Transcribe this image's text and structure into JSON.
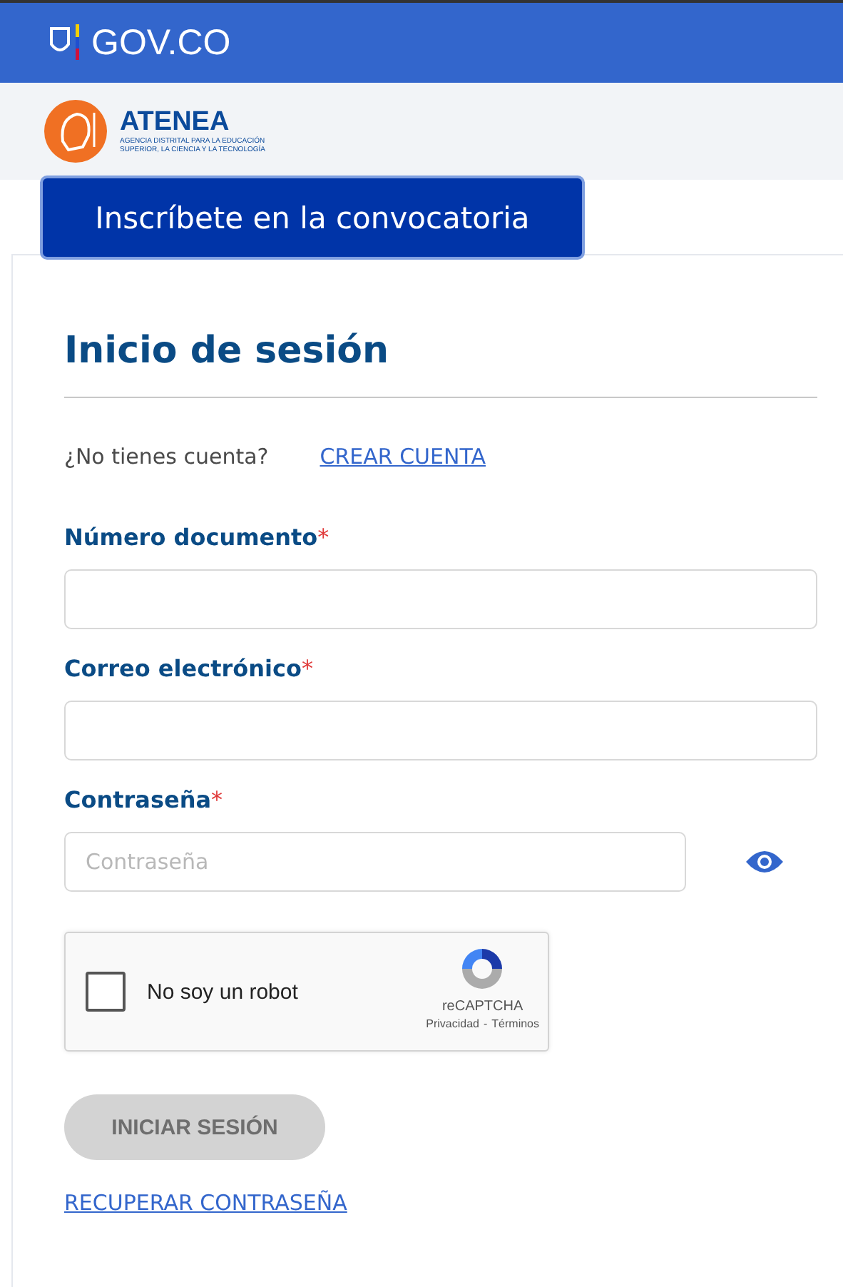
{
  "header": {
    "brand": "GOV.CO"
  },
  "agency": {
    "name": "ATENEA",
    "subtitle_lines": [
      "AGENCIA DISTRITAL PARA LA EDUCACIÓN",
      "SUPERIOR, LA CIENCIA Y LA TECNOLOGÍA"
    ]
  },
  "register_button": "Inscríbete en la convocatoria",
  "login": {
    "title": "Inicio de sesión",
    "no_account": "¿No tienes cuenta?",
    "create_account": "CREAR CUENTA",
    "fields": [
      {
        "kind": "text",
        "label": "Número documento",
        "required_mark": "*"
      },
      {
        "kind": "text",
        "label": "Correo electrónico",
        "required_mark": "*"
      },
      {
        "kind": "password",
        "label": "Contraseña",
        "required_mark": "*",
        "placeholder": "Contraseña"
      }
    ],
    "captcha": {
      "label": "No soy un robot",
      "checked": false,
      "brand": "reCAPTCHA",
      "privacy": "Privacidad",
      "separator": "-",
      "terms": "Términos"
    },
    "submit": {
      "label": "INICIAR SESIÓN",
      "disabled": true
    },
    "recover": "RECUPERAR CONTRASEÑA"
  }
}
